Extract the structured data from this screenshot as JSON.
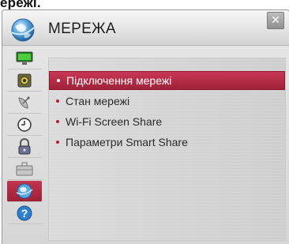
{
  "caption": "ережі.",
  "window": {
    "title": "МЕРЕЖА",
    "close_label": "✕"
  },
  "sidebar": {
    "items": [
      {
        "name": "picture",
        "icon": "tv-screen-icon",
        "active": false
      },
      {
        "name": "sound",
        "icon": "speaker-icon",
        "active": false
      },
      {
        "name": "channel",
        "icon": "satellite-dish-icon",
        "active": false
      },
      {
        "name": "time",
        "icon": "clock-icon",
        "active": false
      },
      {
        "name": "lock",
        "icon": "padlock-icon",
        "active": false
      },
      {
        "name": "option",
        "icon": "briefcase-icon",
        "active": false
      },
      {
        "name": "network",
        "icon": "globe-icon",
        "active": true
      },
      {
        "name": "support",
        "icon": "question-icon",
        "active": false
      }
    ]
  },
  "menu": {
    "items": [
      {
        "label": "Підключення мережі",
        "active": true
      },
      {
        "label": "Стан мережі",
        "active": false
      },
      {
        "label": "Wi-Fi Screen Share",
        "active": false
      },
      {
        "label": "Параметри Smart Share",
        "active": false
      }
    ]
  },
  "colors": {
    "accent": "#b82a45",
    "panel": "#dcdcdc",
    "text": "#2a2a2a"
  }
}
